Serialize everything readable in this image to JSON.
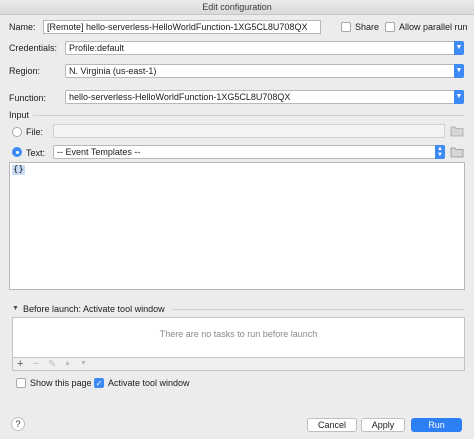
{
  "window": {
    "title": "Edit configuration"
  },
  "form": {
    "name_label": "Name:",
    "name_value": "[Remote] hello-serverless-HelloWorldFunction-1XG5CL8U708QX",
    "share_label": "Share",
    "allow_parallel_label": "Allow parallel run",
    "credentials_label": "Credentials:",
    "credentials_value": "Profile:default",
    "region_label": "Region:",
    "region_value": "N. Virginia (us-east-1)",
    "function_label": "Function:",
    "function_value": "hello-serverless-HelloWorldFunction-1XG5CL8U708QX"
  },
  "input": {
    "section_label": "Input",
    "file_label": "File:",
    "text_label": "Text:",
    "template_value": "-- Event Templates --",
    "editor_content": "{}"
  },
  "before_launch": {
    "header": "Before launch: Activate tool window",
    "empty_message": "There are no tasks to run before launch",
    "toolbar": {
      "add": "+",
      "remove": "−",
      "edit": "✎",
      "up": "▲",
      "down": "▼"
    }
  },
  "options": {
    "show_page_label": "Show this page",
    "activate_tool_label": "Activate tool window"
  },
  "buttons": {
    "help": "?",
    "cancel": "Cancel",
    "apply": "Apply",
    "run": "Run"
  }
}
